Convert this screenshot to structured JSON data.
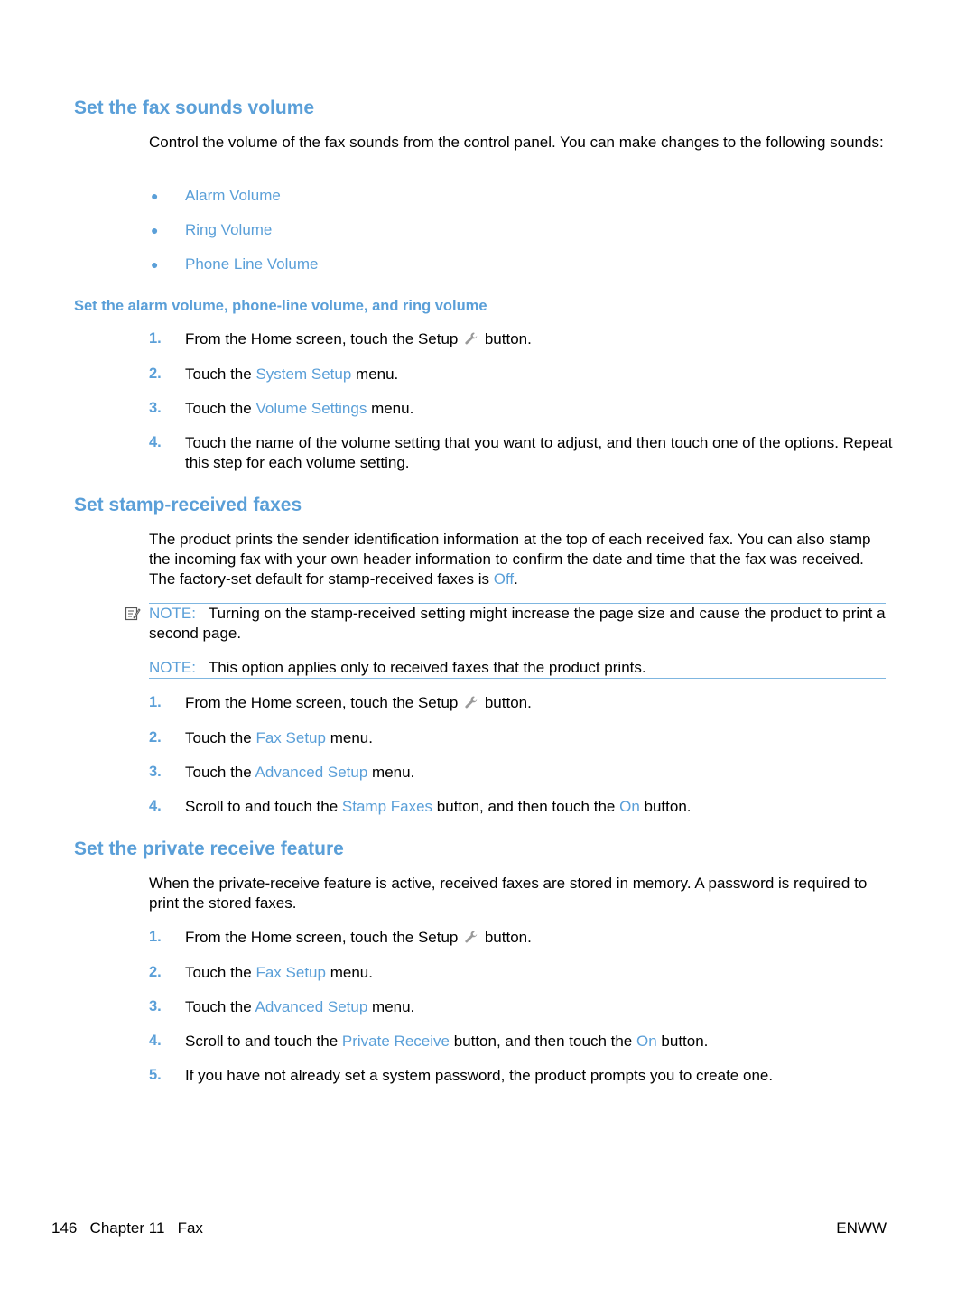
{
  "sections": {
    "fax_sounds": {
      "title": "Set the fax sounds volume",
      "intro": "Control the volume of the fax sounds from the control panel. You can make changes to the following sounds:",
      "bullets": [
        "Alarm Volume",
        "Ring Volume",
        "Phone Line Volume"
      ],
      "subheading": "Set the alarm volume, phone-line volume, and ring volume",
      "steps": [
        {
          "num": "1.",
          "pre": "From the Home screen, touch the Setup",
          "post": "button."
        },
        {
          "num": "2.",
          "pre": "Touch the",
          "link": "System Setup",
          "post": "menu."
        },
        {
          "num": "3.",
          "pre": "Touch the",
          "link": "Volume Settings",
          "post": "menu."
        },
        {
          "num": "4.",
          "pre": "Touch the name of the volume setting that you want to adjust, and then touch one of the options. Repeat this step for each volume setting."
        }
      ]
    },
    "stamp_received": {
      "title": "Set stamp-received faxes",
      "intro_pre": "The product prints the sender identification information at the top of each received fax. You can also stamp the incoming fax with your own header information to confirm the date and time that the fax was received. The factory-set default for stamp-received faxes is",
      "intro_link": "Off",
      "intro_post": ".",
      "notes": [
        {
          "label": "NOTE:",
          "text": "Turning on the stamp-received setting might increase the page size and cause the product to print a second page."
        },
        {
          "label": "NOTE:",
          "text": "This option applies only to received faxes that the product prints."
        }
      ],
      "steps": [
        {
          "num": "1.",
          "pre": "From the Home screen, touch the Setup",
          "post": "button."
        },
        {
          "num": "2.",
          "pre": "Touch the",
          "link": "Fax Setup",
          "post": "menu."
        },
        {
          "num": "3.",
          "pre": "Touch the",
          "link": "Advanced Setup",
          "post": "menu."
        },
        {
          "num": "4.",
          "pre": "Scroll to and touch the",
          "link": "Stamp Faxes",
          "mid": "button, and then touch the",
          "link2": "On",
          "post": "button."
        }
      ]
    },
    "private_receive": {
      "title": "Set the private receive feature",
      "intro": "When the private-receive feature is active, received faxes are stored in memory. A password is required to print the stored faxes.",
      "steps": [
        {
          "num": "1.",
          "pre": "From the Home screen, touch the Setup",
          "post": "button."
        },
        {
          "num": "2.",
          "pre": "Touch the",
          "link": "Fax Setup",
          "post": "menu."
        },
        {
          "num": "3.",
          "pre": "Touch the",
          "link": "Advanced Setup",
          "post": "menu."
        },
        {
          "num": "4.",
          "pre": "Scroll to and touch the",
          "link": "Private Receive",
          "mid": "button, and then touch the",
          "link2": "On",
          "post": "button."
        },
        {
          "num": "5.",
          "pre": "If you have not already set a system password, the product prompts you to create one."
        }
      ]
    }
  },
  "footer": {
    "page_number": "146",
    "chapter": "Chapter 11",
    "chapter_title": "Fax",
    "locale": "ENWW"
  },
  "icons": {
    "setup": "wrench-icon",
    "note": "note-pencil-icon",
    "bullet": "bullet-dot"
  },
  "colors": {
    "accent": "#5a9fd8",
    "rule": "#7fb6e0",
    "text": "#000000"
  }
}
